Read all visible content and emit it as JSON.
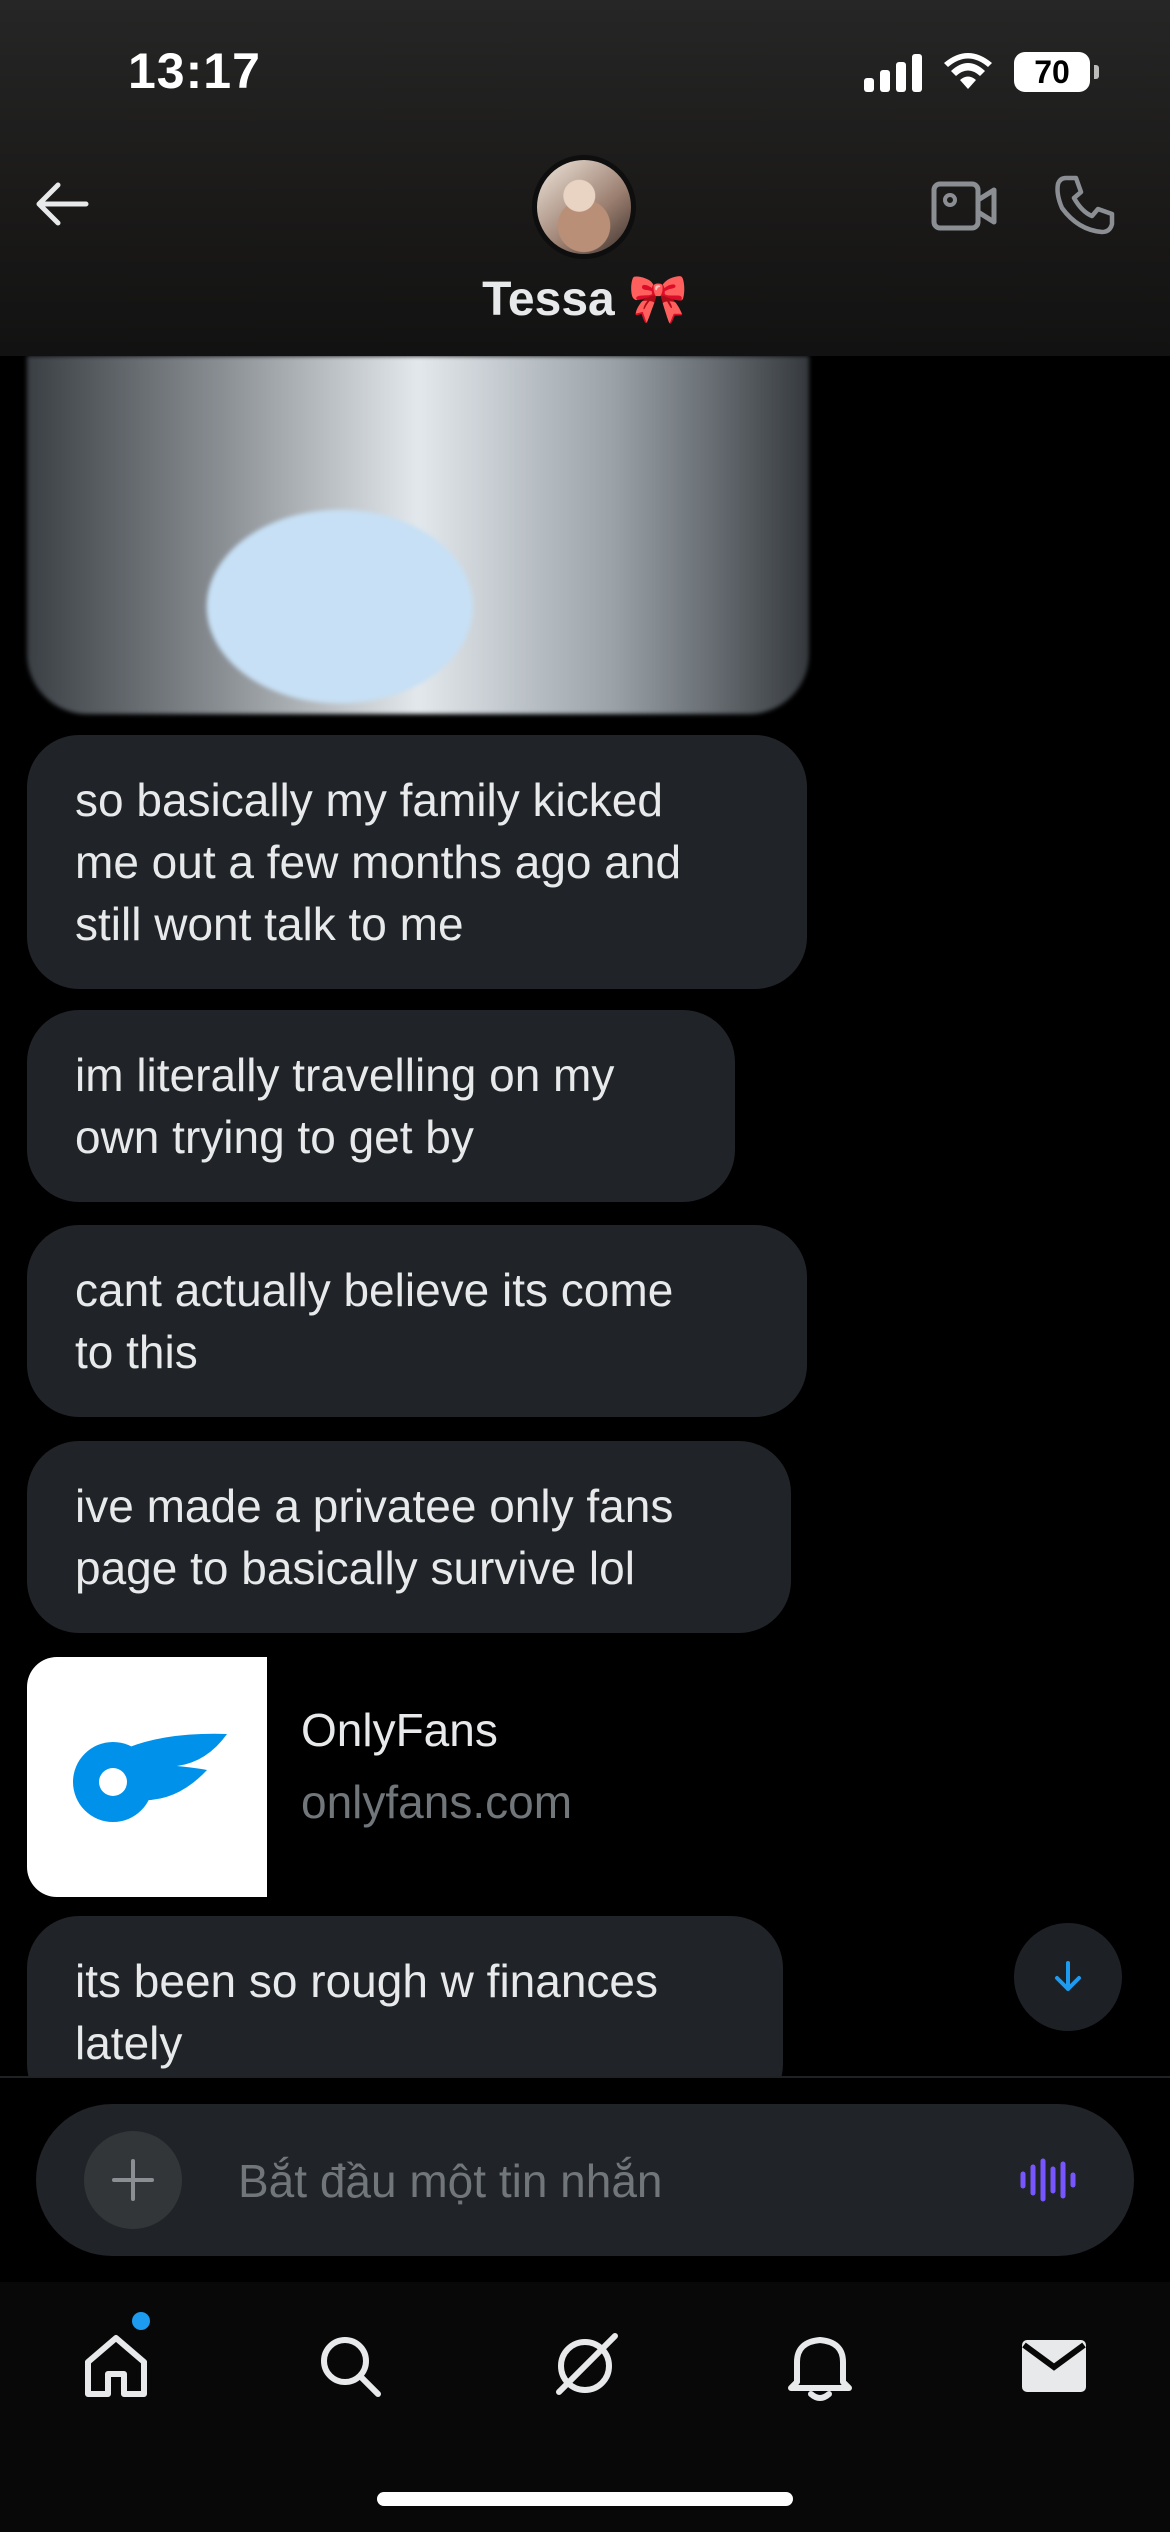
{
  "status_bar": {
    "time": "13:17",
    "battery": "70"
  },
  "header": {
    "contact_name": "Tessa 🎀",
    "icons": [
      "back-arrow-icon",
      "avatar",
      "video-camera-icon",
      "phone-icon"
    ]
  },
  "messages": [
    {
      "type": "image",
      "description_icon": "photo"
    },
    {
      "type": "text",
      "lines": [
        "so basically my family kicked",
        "me out a few months ago and",
        "still wont talk to me"
      ]
    },
    {
      "type": "text",
      "lines": [
        "im literally travelling on my",
        "own trying to get by"
      ]
    },
    {
      "type": "text",
      "lines": [
        "cant actually believe its come",
        "to this"
      ]
    },
    {
      "type": "text",
      "lines": [
        "ive made a privatee only fans",
        "page to basically survive lol"
      ]
    },
    {
      "type": "link",
      "title": "OnlyFans",
      "domain": "onlyfans.com",
      "accent": "#0091ea"
    },
    {
      "type": "text",
      "lines": [
        "its been so rough w finances",
        "lately"
      ]
    }
  ],
  "composer": {
    "placeholder": "Bắt đầu một tin nhắn",
    "accent": "#7856ff"
  },
  "nav": {
    "items": [
      "home-icon",
      "search-icon",
      "grok-icon",
      "notifications-icon",
      "messages-icon"
    ],
    "badge_color": "#1d9bf0"
  }
}
